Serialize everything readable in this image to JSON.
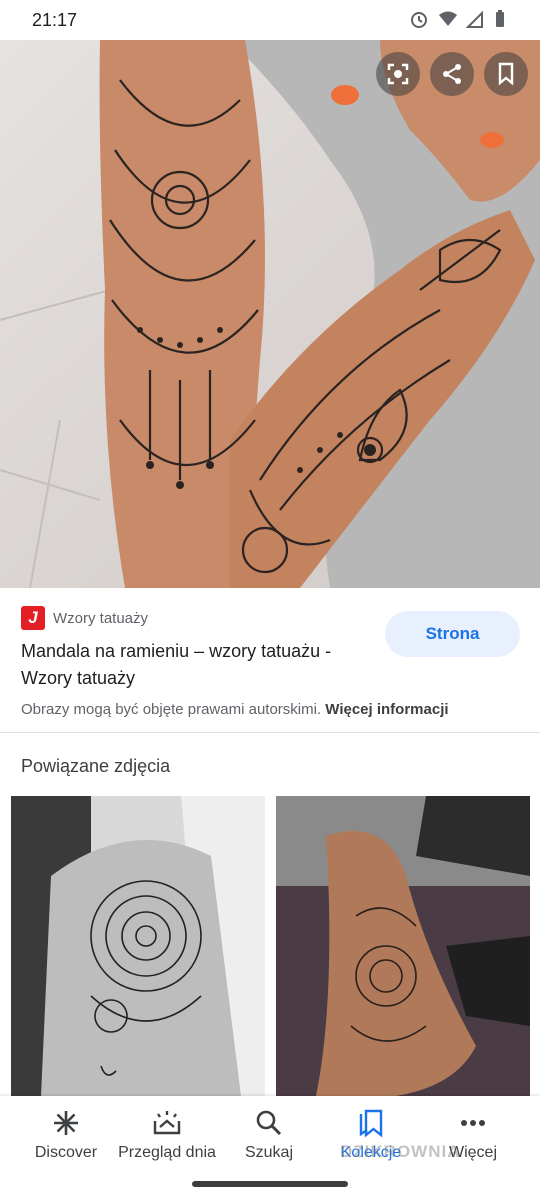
{
  "status_bar": {
    "time": "21:17"
  },
  "hero": {
    "action_icons": [
      "lens-icon",
      "share-icon",
      "bookmark-icon"
    ]
  },
  "result": {
    "source_name": "Wzory tatuaży",
    "source_logo_letter": "J",
    "title": "Mandala na ramieniu – wzory tatuażu - Wzory tatuaży",
    "visit_label": "Strona",
    "copyright_notice": "Obrazy mogą być objęte prawami autorskimi.",
    "more_info_label": "Więcej informacji"
  },
  "related": {
    "title": "Powiązane zdjęcia"
  },
  "bottom_nav": {
    "items": [
      {
        "label": "Discover",
        "icon": "asterisk-icon"
      },
      {
        "label": "Przegląd dnia",
        "icon": "daily-icon"
      },
      {
        "label": "Szukaj",
        "icon": "search-icon"
      },
      {
        "label": "Kolekcje",
        "icon": "collections-icon",
        "active": true
      },
      {
        "label": "Więcej",
        "icon": "more-icon"
      }
    ]
  },
  "watermark": "DZIKROWNIA",
  "colors": {
    "accent": "#1a73e8",
    "visit_button_bg": "#e8f0fe",
    "source_logo": "#e31e24"
  }
}
